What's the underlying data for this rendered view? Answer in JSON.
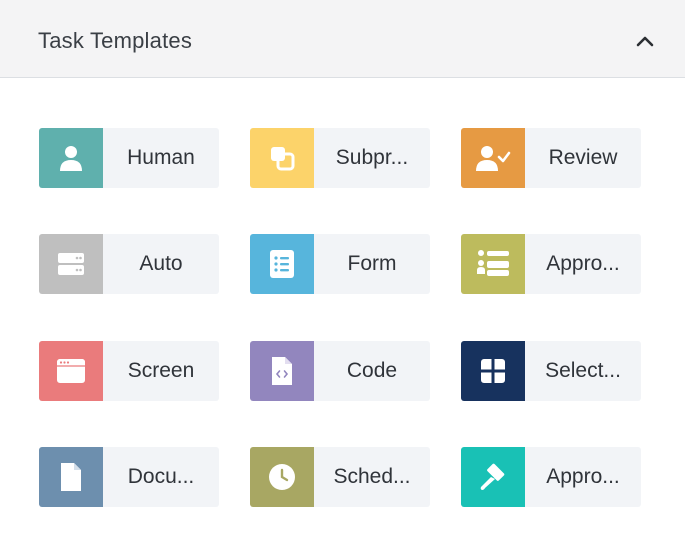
{
  "panel": {
    "title": "Task Templates",
    "collapse_icon": "chevron-up-icon"
  },
  "templates": [
    {
      "label": "Human",
      "icon": "user-icon",
      "color": "#5fb0ad"
    },
    {
      "label": "Subpr...",
      "icon": "subprocess-icon",
      "color": "#fcd36a"
    },
    {
      "label": "Review",
      "icon": "user-check-icon",
      "color": "#e69a43"
    },
    {
      "label": "Auto",
      "icon": "server-icon",
      "color": "#bfbfbf"
    },
    {
      "label": "Form",
      "icon": "form-list-icon",
      "color": "#57b5dc"
    },
    {
      "label": "Appro...",
      "icon": "approval-list-icon",
      "color": "#bdbb5d"
    },
    {
      "label": "Screen",
      "icon": "window-icon",
      "color": "#ea7b7c"
    },
    {
      "label": "Code",
      "icon": "code-file-icon",
      "color": "#9286be"
    },
    {
      "label": "Select...",
      "icon": "grid-icon",
      "color": "#17325e"
    },
    {
      "label": "Docu...",
      "icon": "document-icon",
      "color": "#6d8fae"
    },
    {
      "label": "Sched...",
      "icon": "clock-icon",
      "color": "#a8a763"
    },
    {
      "label": "Appro...",
      "icon": "gavel-icon",
      "color": "#19c1b5"
    }
  ]
}
